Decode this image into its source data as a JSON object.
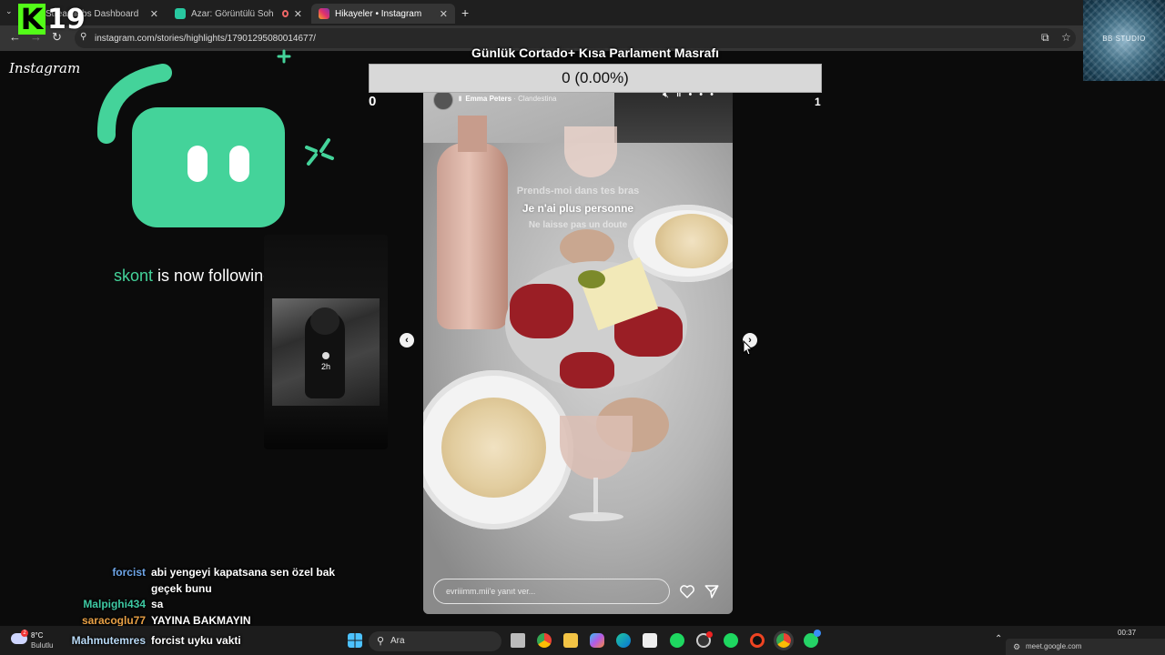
{
  "browser": {
    "tabs": [
      {
        "label": "Streamlabs Dashboard",
        "active": false,
        "favicon_color": "#44d39a"
      },
      {
        "label": "Azar: Görüntülü Sohbet & V",
        "active": false,
        "favicon_color": "#28c8a0"
      },
      {
        "label": "Hikayeler • Instagram",
        "active": true,
        "favicon_color": "#e1306c"
      }
    ],
    "new_tab_label": "+",
    "url": "instagram.com/stories/highlights/17901295080014677/"
  },
  "overlay": {
    "k_logo": "K",
    "k_number": "19",
    "bb_studio": "BB STUDIO"
  },
  "instagram": {
    "logo": "Instagram",
    "previous_story": {
      "age": "2h"
    },
    "story": {
      "username": "Emma Peters",
      "song": "Clandestina",
      "lyrics": [
        "Prends-moi dans tes bras",
        "Je n'ai plus personne",
        "Ne laisse pas un doute"
      ],
      "reply_placeholder": "evriiimm.mii'e yanıt ver..."
    }
  },
  "follow_alert": {
    "username": "skont",
    "text": " is now following!"
  },
  "donation_goal": {
    "title": "Günlük Cortado+ Kısa Parlament Masrafı",
    "progress_text": "0 (0.00%)",
    "progress_fraction": 0,
    "min_label": "0",
    "max_label": "1"
  },
  "chat": [
    {
      "user": "forcist",
      "color": "#6fa6e8",
      "message": "abi yengeyi kapatsana sen özel bak geçek bunu"
    },
    {
      "user": "Malpighi434",
      "color": "#3ec9a3",
      "message": "sa"
    },
    {
      "user": "saracoglu77",
      "color": "#e8a045",
      "message": "YAYINA BAKMAYIN"
    },
    {
      "user": "Mahmutemres",
      "color": "#b8d9f5",
      "message": "forcist uyku vakti"
    }
  ],
  "taskbar": {
    "weather_temp": "8°C",
    "weather_cond": "Bulutlu",
    "weather_badge": "2",
    "search_placeholder": "Ara",
    "clock": "00:37",
    "meet_text": "meet.google.com"
  }
}
